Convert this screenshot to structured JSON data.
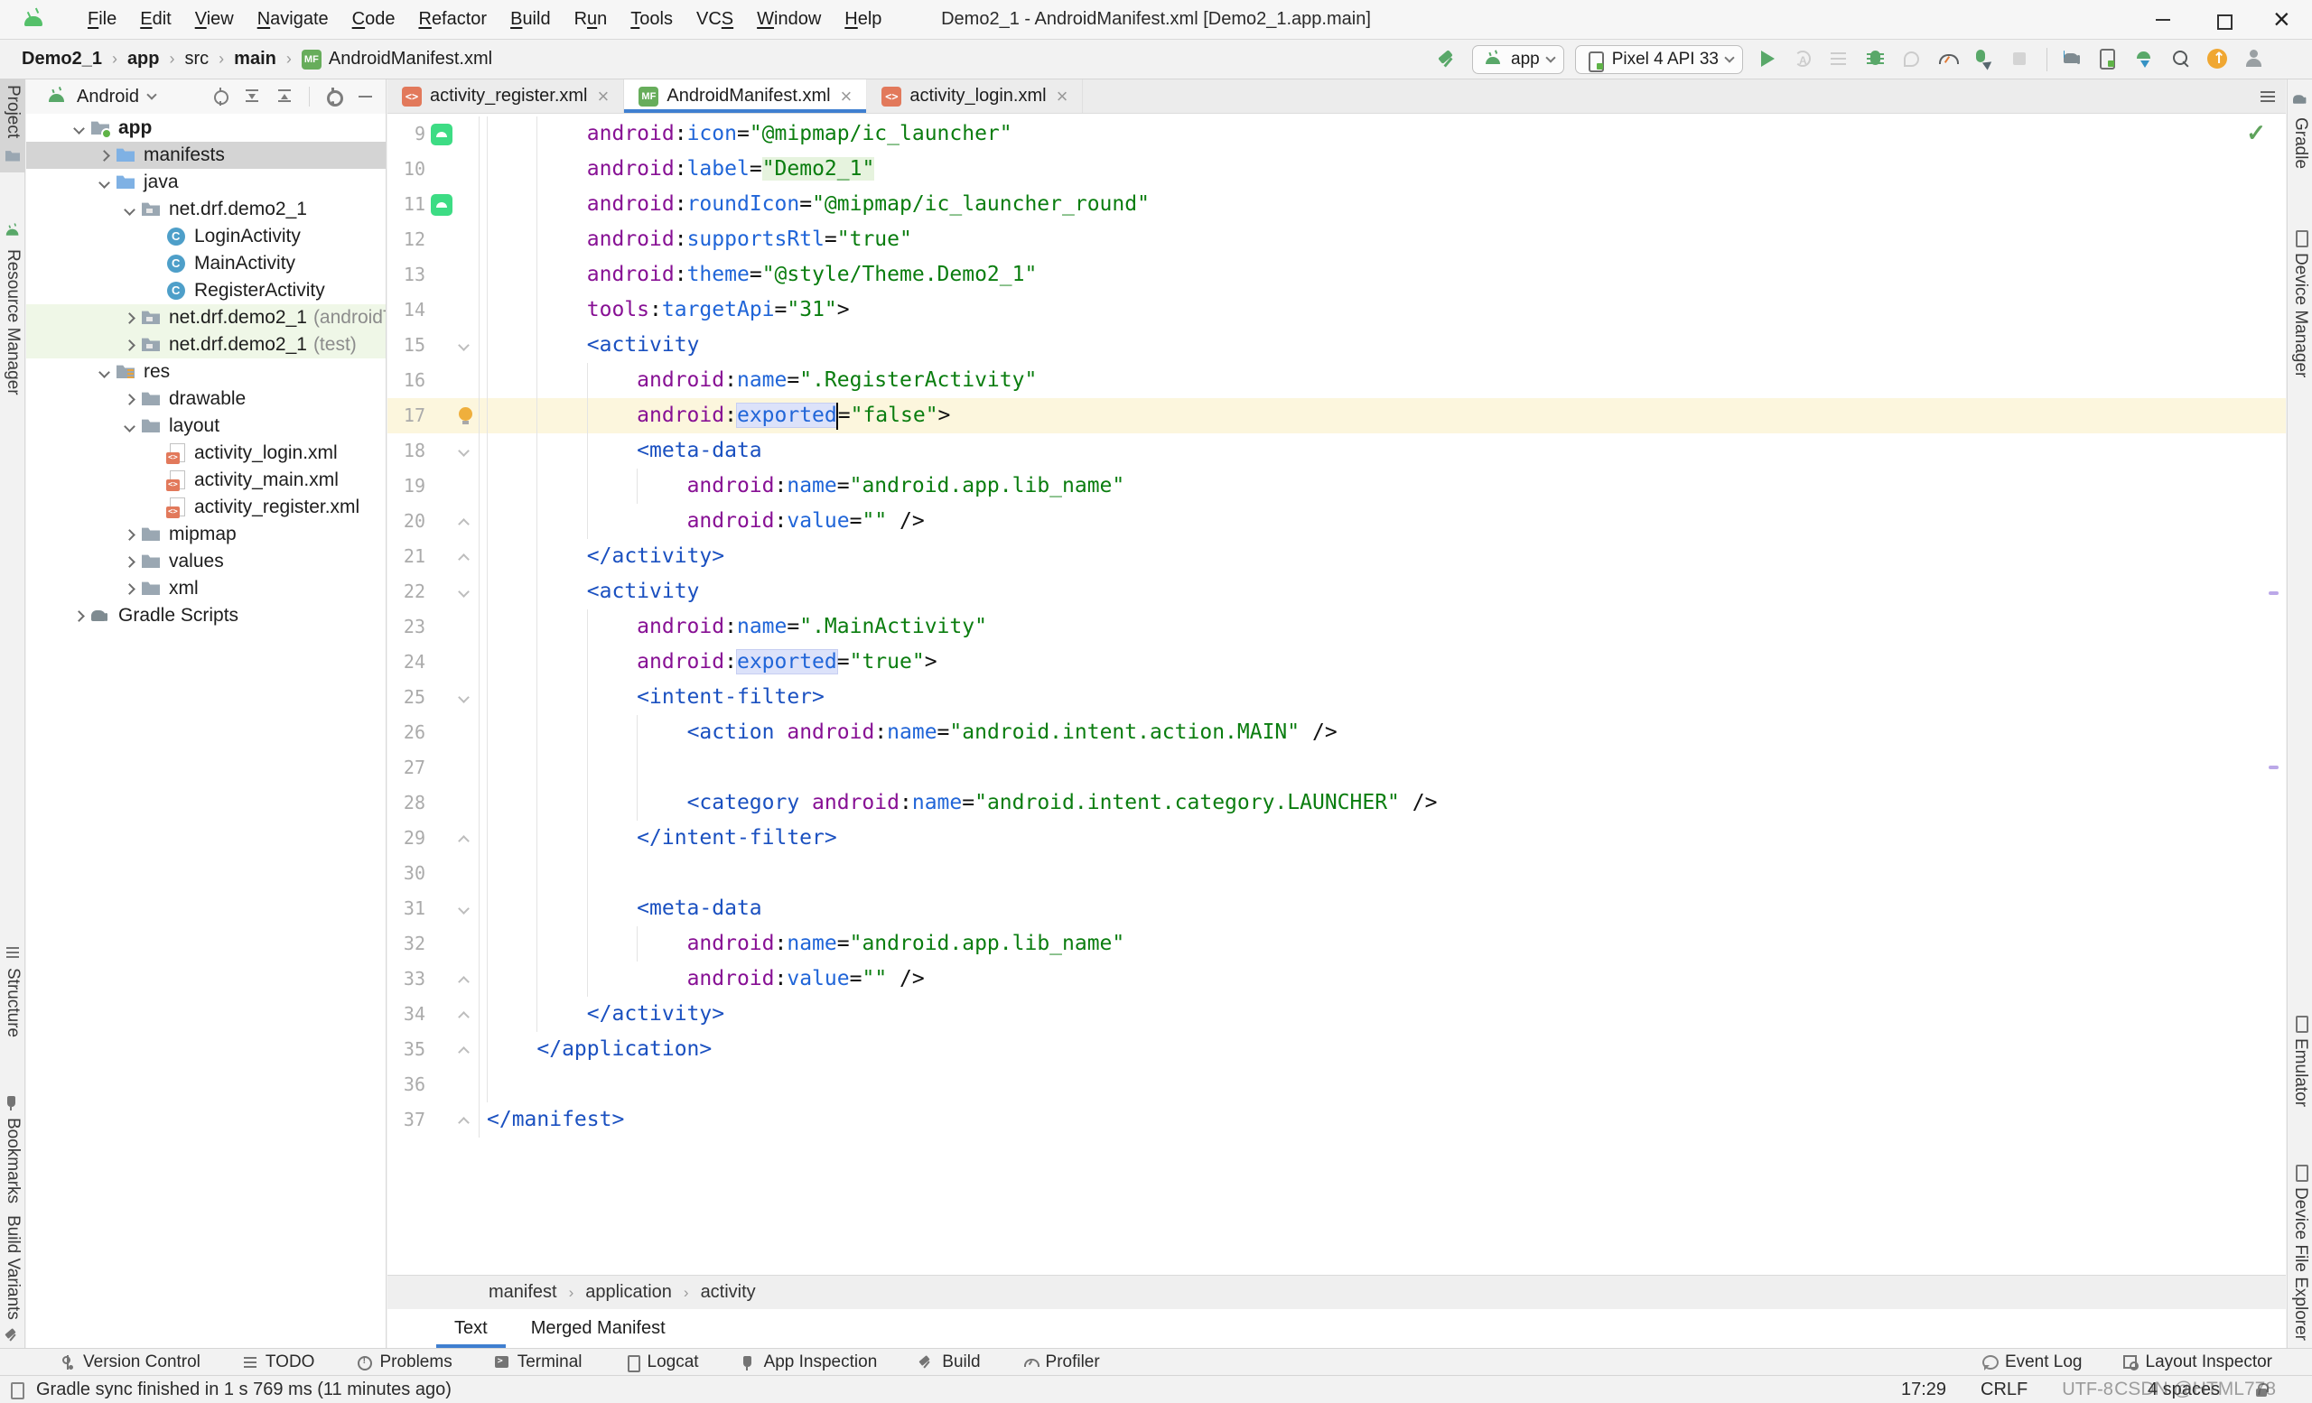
{
  "window": {
    "title": "Demo2_1 - AndroidManifest.xml [Demo2_1.app.main]"
  },
  "menu": [
    "File",
    "Edit",
    "View",
    "Navigate",
    "Code",
    "Refactor",
    "Build",
    "Run",
    "Tools",
    "VCS",
    "Window",
    "Help"
  ],
  "menu_mnemonics": [
    0,
    0,
    0,
    0,
    0,
    0,
    0,
    1,
    0,
    2,
    0,
    0
  ],
  "navbar": {
    "crumbs": [
      {
        "label": "Demo2_1",
        "bold": true
      },
      {
        "label": "app",
        "bold": true
      },
      {
        "label": "src",
        "bold": false
      },
      {
        "label": "main",
        "bold": true
      }
    ],
    "file": "AndroidManifest.xml",
    "file_icon_label": "MF",
    "run_config": "app",
    "device": "Pixel 4 API 33"
  },
  "toolbar_buttons": [
    {
      "name": "run-button",
      "icon": "play"
    },
    {
      "name": "apply-changes-button",
      "icon": "restart",
      "grayed": true
    },
    {
      "name": "apply-code-changes-button",
      "icon": "lines",
      "grayed": true
    },
    {
      "name": "debug-button",
      "icon": "bug"
    },
    {
      "name": "attach-debugger-button",
      "icon": "plug",
      "grayed": true
    },
    {
      "name": "profiler-button",
      "icon": "gauge"
    },
    {
      "name": "profile-app-button",
      "icon": "bug-arrow"
    },
    {
      "name": "stop-button",
      "icon": "stop",
      "grayed": true
    },
    {
      "sep": true
    },
    {
      "name": "sync-gradle-button",
      "icon": "elephant"
    },
    {
      "name": "device-manager-button",
      "icon": "phone"
    },
    {
      "name": "sdk-manager-button",
      "icon": "android-down"
    },
    {
      "name": "search-everywhere-button",
      "icon": "search"
    },
    {
      "name": "ide-update-button",
      "icon": "update"
    },
    {
      "name": "profile-avatar",
      "icon": "avatar"
    }
  ],
  "tabs": [
    {
      "label": "activity_register.xml",
      "icon": "xml",
      "icon_label": "<>",
      "active": false
    },
    {
      "label": "AndroidManifest.xml",
      "icon": "mf",
      "icon_label": "MF",
      "active": true
    },
    {
      "label": "activity_login.xml",
      "icon": "xml",
      "icon_label": "<>",
      "active": false
    }
  ],
  "project": {
    "view": "Android",
    "tree": [
      {
        "d": 0,
        "c": "v",
        "i": "module",
        "l": "app",
        "b": 1
      },
      {
        "d": 1,
        "c": "r",
        "i": "fblue",
        "l": "manifests",
        "sel": 1
      },
      {
        "d": 1,
        "c": "v",
        "i": "fblue",
        "l": "java"
      },
      {
        "d": 2,
        "c": "v",
        "i": "pkg",
        "l": "net.drf.demo2_1"
      },
      {
        "d": 3,
        "i": "cls",
        "l": "LoginActivity"
      },
      {
        "d": 3,
        "i": "cls",
        "l": "MainActivity"
      },
      {
        "d": 3,
        "i": "cls",
        "l": "RegisterActivity"
      },
      {
        "d": 2,
        "c": "r",
        "i": "pkg",
        "l": "net.drf.demo2_1",
        "s": "(androidTest)",
        "g": 1
      },
      {
        "d": 2,
        "c": "r",
        "i": "pkg",
        "l": "net.drf.demo2_1",
        "s": "(test)",
        "g": 1
      },
      {
        "d": 1,
        "c": "v",
        "i": "fres",
        "l": "res"
      },
      {
        "d": 2,
        "c": "r",
        "i": "fgray",
        "l": "drawable"
      },
      {
        "d": 2,
        "c": "v",
        "i": "fgray",
        "l": "layout"
      },
      {
        "d": 3,
        "i": "xmlf",
        "l": "activity_login.xml"
      },
      {
        "d": 3,
        "i": "xmlf",
        "l": "activity_main.xml"
      },
      {
        "d": 3,
        "i": "xmlf",
        "l": "activity_register.xml"
      },
      {
        "d": 2,
        "c": "r",
        "i": "fgray",
        "l": "mipmap"
      },
      {
        "d": 2,
        "c": "r",
        "i": "fgray",
        "l": "values"
      },
      {
        "d": 2,
        "c": "r",
        "i": "fgray",
        "l": "xml"
      },
      {
        "d": 0,
        "c": "r",
        "i": "gradle",
        "l": "Gradle Scripts"
      }
    ]
  },
  "editor": {
    "lines": [
      {
        "n": 9,
        "g": 1,
        "t": [
          [
            "        ",
            ""
          ],
          [
            "android",
            "n"
          ],
          [
            ":",
            "p"
          ],
          [
            "icon",
            "a"
          ],
          [
            "=",
            "p"
          ],
          [
            "\"@mipmap/ic_launcher\"",
            "s"
          ]
        ]
      },
      {
        "n": 10,
        "t": [
          [
            "        ",
            ""
          ],
          [
            "android",
            "n"
          ],
          [
            ":",
            "p"
          ],
          [
            "label",
            "a"
          ],
          [
            "=",
            "p"
          ],
          [
            "\"Demo2_1\"",
            "s g"
          ]
        ]
      },
      {
        "n": 11,
        "g": 1,
        "t": [
          [
            "        ",
            ""
          ],
          [
            "android",
            "n"
          ],
          [
            ":",
            "p"
          ],
          [
            "roundIcon",
            "a"
          ],
          [
            "=",
            "p"
          ],
          [
            "\"@mipmap/ic_launcher_round\"",
            "s"
          ]
        ]
      },
      {
        "n": 12,
        "t": [
          [
            "        ",
            ""
          ],
          [
            "android",
            "n"
          ],
          [
            ":",
            "p"
          ],
          [
            "supportsRtl",
            "a"
          ],
          [
            "=",
            "p"
          ],
          [
            "\"true\"",
            "s"
          ]
        ]
      },
      {
        "n": 13,
        "t": [
          [
            "        ",
            ""
          ],
          [
            "android",
            "n"
          ],
          [
            ":",
            "p"
          ],
          [
            "theme",
            "a"
          ],
          [
            "=",
            "p"
          ],
          [
            "\"@style/Theme.Demo2_1\"",
            "s"
          ]
        ]
      },
      {
        "n": 14,
        "t": [
          [
            "        ",
            ""
          ],
          [
            "tools",
            "n"
          ],
          [
            ":",
            "p"
          ],
          [
            "targetApi",
            "a"
          ],
          [
            "=",
            "p"
          ],
          [
            "\"31\"",
            "s"
          ],
          [
            ">",
            "p"
          ]
        ]
      },
      {
        "n": 15,
        "f": "o",
        "t": [
          [
            "        ",
            ""
          ],
          [
            "<activity",
            "t"
          ]
        ]
      },
      {
        "n": 16,
        "t": [
          [
            "            ",
            ""
          ],
          [
            "android",
            "n"
          ],
          [
            ":",
            "p"
          ],
          [
            "name",
            "a"
          ],
          [
            "=",
            "p"
          ],
          [
            "\".RegisterActivity\"",
            "s"
          ]
        ]
      },
      {
        "n": 17,
        "bulb": 1,
        "cur": 1,
        "t": [
          [
            "            ",
            ""
          ],
          [
            "android",
            "n"
          ],
          [
            ":",
            "p"
          ],
          [
            "exported",
            "a b"
          ],
          [
            "",
            "caret"
          ],
          [
            "=",
            "p"
          ],
          [
            "\"false\"",
            "s"
          ],
          [
            ">",
            "p"
          ]
        ]
      },
      {
        "n": 18,
        "f": "o",
        "t": [
          [
            "            ",
            ""
          ],
          [
            "<meta-data",
            "t"
          ]
        ]
      },
      {
        "n": 19,
        "t": [
          [
            "                ",
            ""
          ],
          [
            "android",
            "n"
          ],
          [
            ":",
            "p"
          ],
          [
            "name",
            "a"
          ],
          [
            "=",
            "p"
          ],
          [
            "\"android.app.lib_name\"",
            "s"
          ]
        ]
      },
      {
        "n": 20,
        "f": "c",
        "t": [
          [
            "                ",
            ""
          ],
          [
            "android",
            "n"
          ],
          [
            ":",
            "p"
          ],
          [
            "value",
            "a"
          ],
          [
            "=",
            "p"
          ],
          [
            "\"\"",
            "s"
          ],
          [
            " />",
            "p"
          ]
        ]
      },
      {
        "n": 21,
        "f": "c",
        "t": [
          [
            "        ",
            ""
          ],
          [
            "</activity>",
            "t"
          ]
        ]
      },
      {
        "n": 22,
        "f": "o",
        "t": [
          [
            "        ",
            ""
          ],
          [
            "<activity",
            "t"
          ]
        ]
      },
      {
        "n": 23,
        "t": [
          [
            "            ",
            ""
          ],
          [
            "android",
            "n"
          ],
          [
            ":",
            "p"
          ],
          [
            "name",
            "a"
          ],
          [
            "=",
            "p"
          ],
          [
            "\".MainActivity\"",
            "s"
          ]
        ]
      },
      {
        "n": 24,
        "t": [
          [
            "            ",
            ""
          ],
          [
            "android",
            "n"
          ],
          [
            ":",
            "p"
          ],
          [
            "exported",
            "a b"
          ],
          [
            "=",
            "p"
          ],
          [
            "\"true\"",
            "s"
          ],
          [
            ">",
            "p"
          ]
        ]
      },
      {
        "n": 25,
        "f": "o",
        "t": [
          [
            "            ",
            ""
          ],
          [
            "<intent-filter>",
            "t"
          ]
        ]
      },
      {
        "n": 26,
        "t": [
          [
            "                ",
            ""
          ],
          [
            "<action",
            "t"
          ],
          [
            " ",
            ""
          ],
          [
            "android",
            "n"
          ],
          [
            ":",
            "p"
          ],
          [
            "name",
            "a"
          ],
          [
            "=",
            "p"
          ],
          [
            "\"android.intent.action.MAIN\"",
            "s"
          ],
          [
            " />",
            "p"
          ]
        ]
      },
      {
        "n": 27,
        "t": []
      },
      {
        "n": 28,
        "t": [
          [
            "                ",
            ""
          ],
          [
            "<category",
            "t"
          ],
          [
            " ",
            ""
          ],
          [
            "android",
            "n"
          ],
          [
            ":",
            "p"
          ],
          [
            "name",
            "a"
          ],
          [
            "=",
            "p"
          ],
          [
            "\"android.intent.category.LAUNCHER\"",
            "s"
          ],
          [
            " />",
            "p"
          ]
        ]
      },
      {
        "n": 29,
        "f": "c",
        "t": [
          [
            "            ",
            ""
          ],
          [
            "</intent-filter>",
            "t"
          ]
        ]
      },
      {
        "n": 30,
        "t": []
      },
      {
        "n": 31,
        "f": "o",
        "t": [
          [
            "            ",
            ""
          ],
          [
            "<meta-data",
            "t"
          ]
        ]
      },
      {
        "n": 32,
        "t": [
          [
            "                ",
            ""
          ],
          [
            "android",
            "n"
          ],
          [
            ":",
            "p"
          ],
          [
            "name",
            "a"
          ],
          [
            "=",
            "p"
          ],
          [
            "\"android.app.lib_name\"",
            "s"
          ]
        ]
      },
      {
        "n": 33,
        "f": "c",
        "t": [
          [
            "                ",
            ""
          ],
          [
            "android",
            "n"
          ],
          [
            ":",
            "p"
          ],
          [
            "value",
            "a"
          ],
          [
            "=",
            "p"
          ],
          [
            "\"\"",
            "s"
          ],
          [
            " />",
            "p"
          ]
        ]
      },
      {
        "n": 34,
        "f": "c",
        "t": [
          [
            "        ",
            ""
          ],
          [
            "</activity>",
            "t"
          ]
        ]
      },
      {
        "n": 35,
        "f": "c",
        "t": [
          [
            "    ",
            ""
          ],
          [
            "</application>",
            "t"
          ]
        ]
      },
      {
        "n": 36,
        "t": []
      },
      {
        "n": 37,
        "f": "c",
        "t": [
          [
            "</manifest>",
            "t"
          ]
        ]
      }
    ],
    "breadcrumbs": [
      "manifest",
      "application",
      "activity"
    ],
    "bottom_tabs": [
      {
        "label": "Text",
        "active": true
      },
      {
        "label": "Merged Manifest",
        "active": false
      }
    ]
  },
  "bottom_bar": {
    "left": [
      {
        "l": "Version Control",
        "i": "vc"
      },
      {
        "l": "TODO",
        "i": "todo"
      },
      {
        "l": "Problems",
        "i": "problems"
      },
      {
        "l": "Terminal",
        "i": "terminal"
      },
      {
        "l": "Logcat",
        "i": "logcat"
      },
      {
        "l": "App Inspection",
        "i": "inspect"
      },
      {
        "l": "Build",
        "i": "hammer"
      },
      {
        "l": "Profiler",
        "i": "gauge"
      }
    ],
    "right": [
      {
        "l": "Event Log",
        "i": "event"
      },
      {
        "l": "Layout Inspector",
        "i": "layoutins"
      }
    ]
  },
  "statusbar": {
    "message": "Gradle sync finished in 1 s 769 ms (11 minutes ago)",
    "position": "17:29",
    "line_ending": "CRLF",
    "encoding": "UTF-8",
    "indent": "4 spaces",
    "watermark": "CSDN @HTML778"
  },
  "stripes": {
    "left_top": [
      "Project",
      "Resource Manager"
    ],
    "left_bottom": [
      "Structure",
      "Bookmarks",
      "Build Variants"
    ],
    "right_top": [
      "Gradle",
      "Device Manager"
    ],
    "right_bottom": [
      "Emulator",
      "Device File Explorer"
    ]
  },
  "colors": {
    "accent_blue": "#3F7FD0",
    "android_green": "#3DDC84",
    "update_orange": "#F0A732"
  }
}
